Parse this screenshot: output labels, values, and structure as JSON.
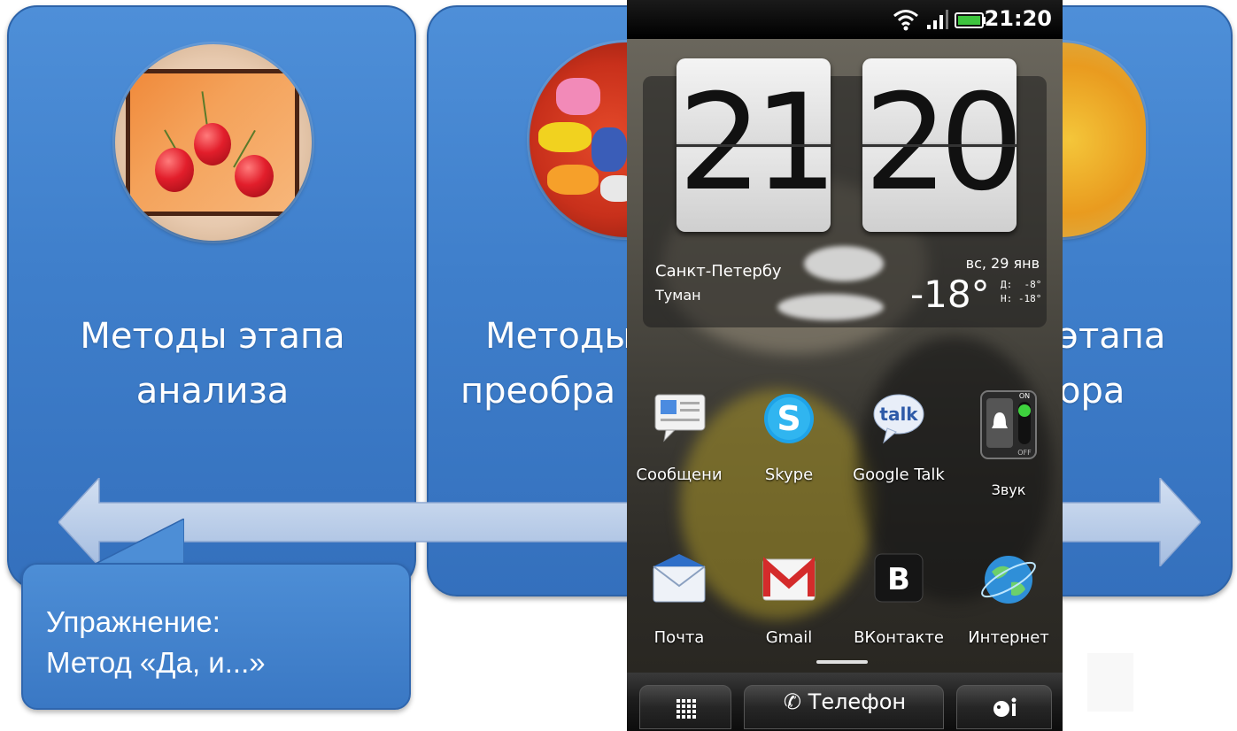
{
  "slide": {
    "cards": [
      {
        "line1": "Методы этапа",
        "line2": "анализа"
      },
      {
        "line1": "Методы",
        "line2": "преобра"
      },
      {
        "line1": "этапа",
        "line2": "ора"
      }
    ],
    "callout": {
      "line1": "Упражнение:",
      "line2": "Метод «Да, и...»"
    },
    "colors": {
      "card_blue": "#3f7fcb",
      "arrow": "#b7c9e6",
      "text": "#ffffff"
    }
  },
  "phone": {
    "status": {
      "time": "21:20"
    },
    "clock": {
      "hours": "21",
      "minutes": "20"
    },
    "weather": {
      "city": "Санкт-Петербу",
      "condition": "Туман",
      "date": "вс, 29 янв",
      "temperature": "-18°",
      "high_low": "Д:  -8°\nН: -18°"
    },
    "apps_row1": [
      {
        "label": "Сообщени",
        "icon": "messages-icon"
      },
      {
        "label": "Skype",
        "icon": "skype-icon"
      },
      {
        "label": "Google Talk",
        "icon": "google-talk-icon"
      },
      {
        "label": "Звук",
        "icon": "sound-toggle-icon"
      }
    ],
    "apps_row2": [
      {
        "label": "Почта",
        "icon": "mail-icon"
      },
      {
        "label": "Gmail",
        "icon": "gmail-icon"
      },
      {
        "label": "ВКонтакте",
        "icon": "vkontakte-icon"
      },
      {
        "label": "Интернет",
        "icon": "browser-icon"
      }
    ],
    "app_glyphs": {
      "skype": "S",
      "talk": "talk",
      "vk": "B",
      "sound_on": "ON",
      "sound_off": "OFF"
    },
    "dock": {
      "phone_label": "Телефон"
    }
  }
}
